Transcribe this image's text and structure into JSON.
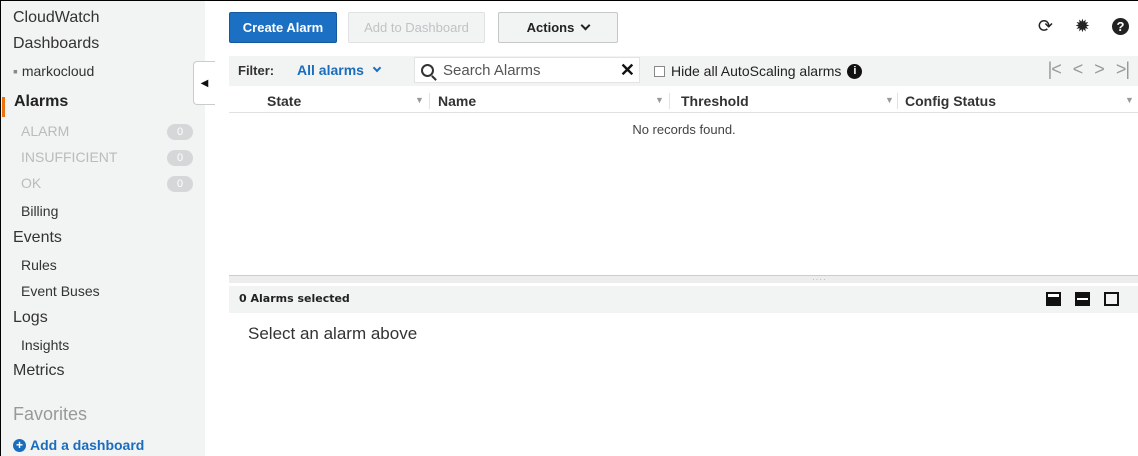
{
  "sidebar": {
    "cloudwatch": "CloudWatch",
    "dashboards": "Dashboards",
    "dashboard_item": "markocloud",
    "alarms": "Alarms",
    "alarm_states": [
      {
        "label": "ALARM",
        "count": "0"
      },
      {
        "label": "INSUFFICIENT",
        "count": "0"
      },
      {
        "label": "OK",
        "count": "0"
      }
    ],
    "billing": "Billing",
    "events": "Events",
    "rules": "Rules",
    "event_buses": "Event Buses",
    "logs": "Logs",
    "insights": "Insights",
    "metrics": "Metrics",
    "favorites": "Favorites",
    "add_dashboard": "Add a dashboard",
    "accent_color": "#ec7211"
  },
  "toolbar": {
    "create_alarm": "Create Alarm",
    "add_to_dashboard": "Add to Dashboard",
    "actions": "Actions",
    "icons": [
      "refresh-icon",
      "gear-icon",
      "help-icon"
    ]
  },
  "filter": {
    "label": "Filter:",
    "selected": "All alarms",
    "search_placeholder": "Search Alarms",
    "hide_autoscaling": "Hide all AutoScaling alarms"
  },
  "table": {
    "columns": [
      "State",
      "Name",
      "Threshold",
      "Config Status"
    ],
    "empty_message": "No records found."
  },
  "details": {
    "selected_count": "0 Alarms selected",
    "placeholder": "Select an alarm above"
  },
  "colors": {
    "primary_button": "#1b70c4",
    "link": "#1a6dbd"
  }
}
